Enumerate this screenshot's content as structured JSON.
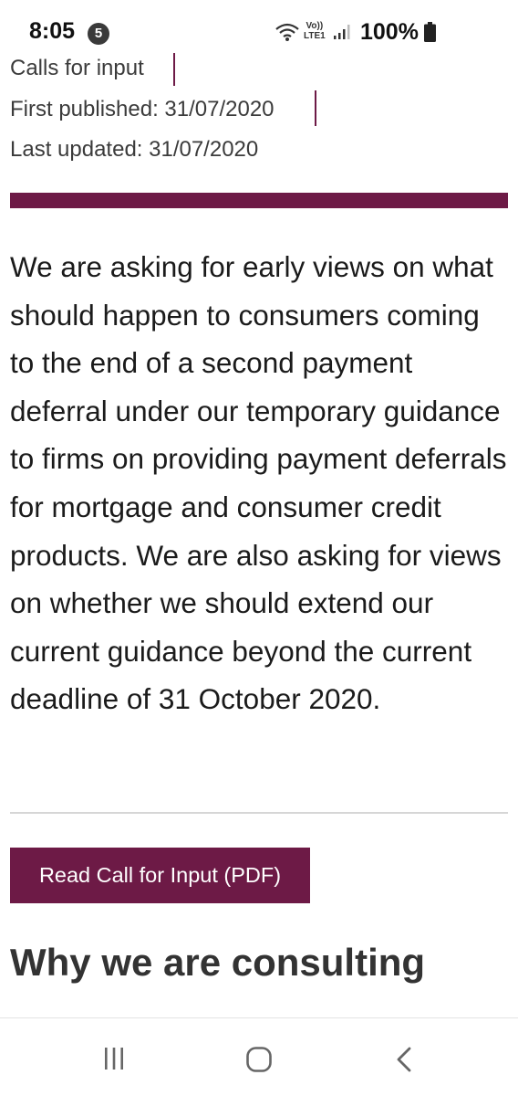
{
  "status_bar": {
    "time": "8:05",
    "notification_count": "5",
    "network_label_top": "Vo))",
    "network_label_bottom": "LTE1",
    "battery": "100%"
  },
  "meta": {
    "category": "Calls for input",
    "first_published": "First published: 31/07/2020",
    "last_updated": "Last updated: 31/07/2020"
  },
  "body": {
    "paragraph": "We are asking for early views on what should happen to consumers coming to the end of a second payment deferral under our temporary guidance to firms on providing payment deferrals for mortgage and consumer credit products. We are also asking for views on whether we should extend our current guidance beyond the current deadline of 31 October 2020."
  },
  "actions": {
    "pdf_button_label": "Read Call for Input (PDF)"
  },
  "section": {
    "heading": "Why we are consulting"
  },
  "colors": {
    "accent": "#6d1a46",
    "text": "#1b1b1b"
  },
  "icons": {
    "nav": [
      "recent-apps-icon",
      "home-icon",
      "back-icon"
    ]
  }
}
